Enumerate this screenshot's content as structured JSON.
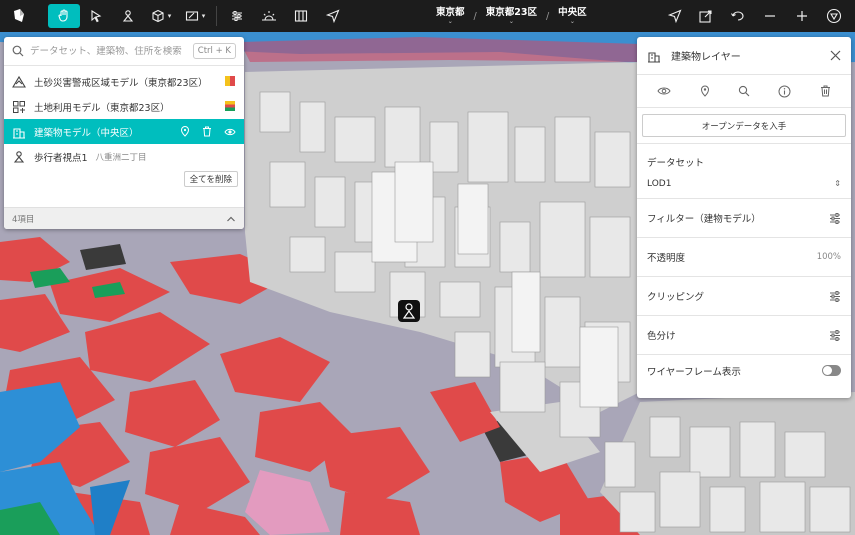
{
  "toolbar": {
    "tools": [
      "logo-icon",
      "hand-icon",
      "pointer-icon",
      "pedestrian-icon",
      "cube-icon",
      "sketch-icon",
      "adjust-icon",
      "horizon-icon",
      "split-view-icon",
      "send-icon"
    ],
    "right_tools": [
      "navigate-icon",
      "export-icon",
      "undo-icon",
      "zoom-out-icon",
      "zoom-in-icon",
      "compass-icon"
    ]
  },
  "breadcrumb": {
    "prefecture": "東京都",
    "city": "東京都23区",
    "ward": "中央区"
  },
  "search": {
    "placeholder": "データセット、建築物、住所を検索",
    "shortcut": "Ctrl + K"
  },
  "layers": [
    {
      "label": "土砂災害警戒区域モデル（東京都23区）",
      "icon": "hazard-icon"
    },
    {
      "label": "土地利用モデル（東京都23区）",
      "icon": "landuse-icon"
    },
    {
      "label": "建築物モデル（中央区）",
      "icon": "building-icon",
      "selected": true
    },
    {
      "label": "歩行者視点1",
      "sub": "八重洲二丁目",
      "icon": "pedestrian-icon"
    }
  ],
  "clear_all": "全てを削除",
  "item_count": "4項目",
  "panel": {
    "title": "建築物レイヤー",
    "open_data": "オープンデータを入手",
    "dataset_label": "データセット",
    "dataset_value": "LOD1",
    "filter_label": "フィルター（建物モデル）",
    "opacity_label": "不透明度",
    "opacity_value": "100%",
    "clipping_label": "クリッピング",
    "coloring_label": "色分け",
    "wireframe_label": "ワイヤーフレーム表示"
  },
  "colors": {
    "accent": "#00bebe",
    "toolbar_bg": "#1c1c1c",
    "landuse_red": "#e04a4a",
    "landuse_pink": "#e39bbf",
    "water": "#2d8fd6",
    "green": "#1a9e5a",
    "road": "#aaa6b8"
  }
}
